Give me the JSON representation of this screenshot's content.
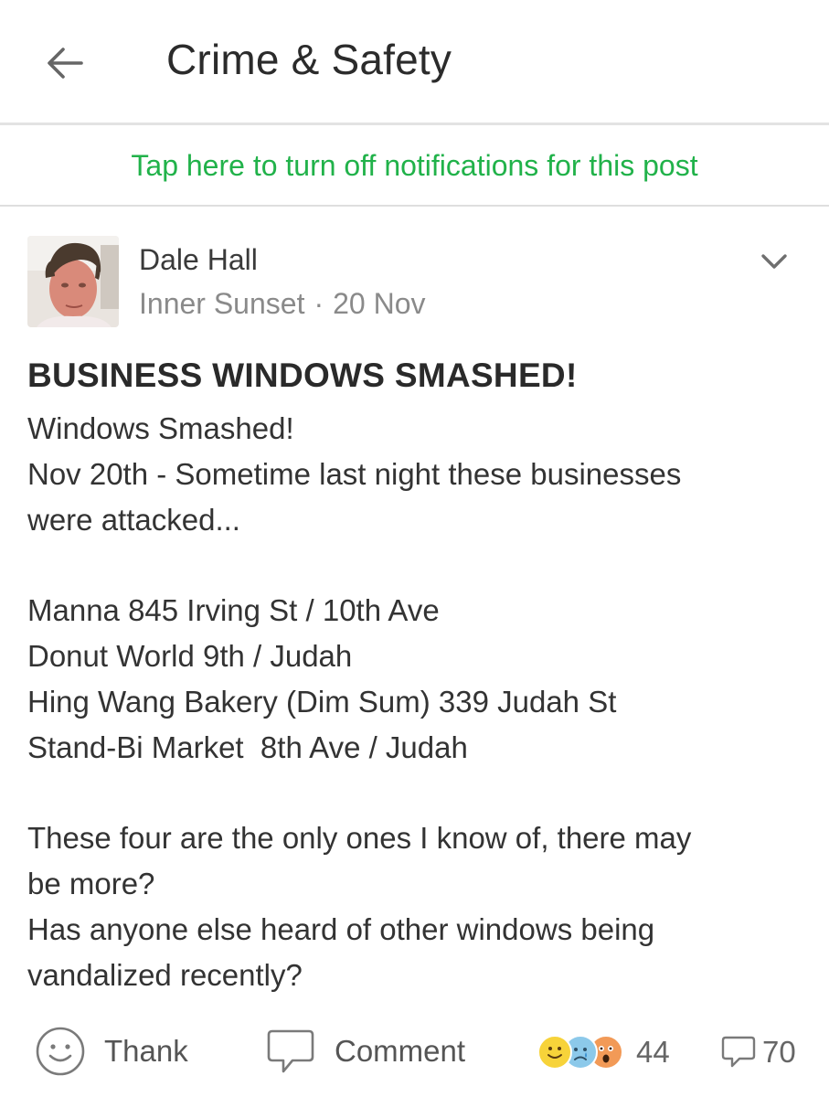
{
  "header": {
    "title": "Crime & Safety",
    "back_icon": "arrow-left-icon"
  },
  "notification_bar": {
    "text": "Tap here to turn off notifications for this post",
    "color": "#21b24a"
  },
  "post": {
    "author": {
      "name": "Dale Hall",
      "neighborhood": "Inner Sunset",
      "separator": "·",
      "date": "20 Nov",
      "avatar_icon": "profile-photo"
    },
    "menu_icon": "chevron-down-icon",
    "title": "BUSINESS WINDOWS SMASHED!",
    "body_lines": [
      "Windows Smashed!",
      "Nov 20th - Sometime last night these businesses",
      "were attacked...",
      "",
      "Manna 845 Irving St / 10th Ave",
      "Donut World 9th / Judah",
      "Hing Wang Bakery (Dim Sum) 339 Judah St",
      "Stand-Bi Market  8th Ave / Judah",
      "",
      "These four are the only ones I know of, there may",
      "be more?",
      "Has anyone else heard of other windows being",
      "vandalized recently?"
    ]
  },
  "actions": {
    "thank_label": "Thank",
    "thank_icon": "smiley-outline-icon",
    "comment_label": "Comment",
    "comment_icon": "speech-bubble-icon",
    "reaction_icons": [
      "smile-emoji-icon",
      "sad-emoji-icon",
      "shocked-emoji-icon"
    ],
    "reaction_count": "44",
    "comment_count": "70",
    "comment_count_icon": "speech-bubble-small-icon"
  }
}
